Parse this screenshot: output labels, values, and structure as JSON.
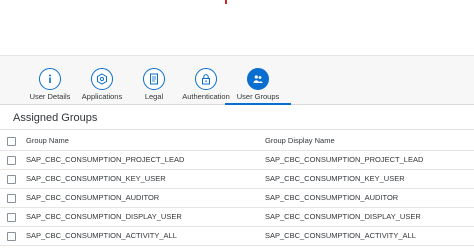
{
  "colors": {
    "accent": "#0a6ed1",
    "brand_red": "#d0271d"
  },
  "tabs": [
    {
      "label": "User Details",
      "icon": "info-icon",
      "selected": false
    },
    {
      "label": "Applications",
      "icon": "applications-icon",
      "selected": false
    },
    {
      "label": "Legal",
      "icon": "legal-document-icon",
      "selected": false
    },
    {
      "label": "Authentication",
      "icon": "lock-icon",
      "selected": false
    },
    {
      "label": "User Groups",
      "icon": "user-groups-icon",
      "selected": true
    }
  ],
  "section": {
    "title": "Assigned Groups"
  },
  "table": {
    "columns": [
      "Group Name",
      "Group Display Name"
    ],
    "rows": [
      [
        "SAP_CBC_CONSUMPTION_PROJECT_LEAD",
        "SAP_CBC_CONSUMPTION_PROJECT_LEAD"
      ],
      [
        "SAP_CBC_CONSUMPTION_KEY_USER",
        "SAP_CBC_CONSUMPTION_KEY_USER"
      ],
      [
        "SAP_CBC_CONSUMPTION_AUDITOR",
        "SAP_CBC_CONSUMPTION_AUDITOR"
      ],
      [
        "SAP_CBC_CONSUMPTION_DISPLAY_USER",
        "SAP_CBC_CONSUMPTION_DISPLAY_USER"
      ],
      [
        "SAP_CBC_CONSUMPTION_ACTIVITY_ALL",
        "SAP_CBC_CONSUMPTION_ACTIVITY_ALL"
      ]
    ]
  }
}
